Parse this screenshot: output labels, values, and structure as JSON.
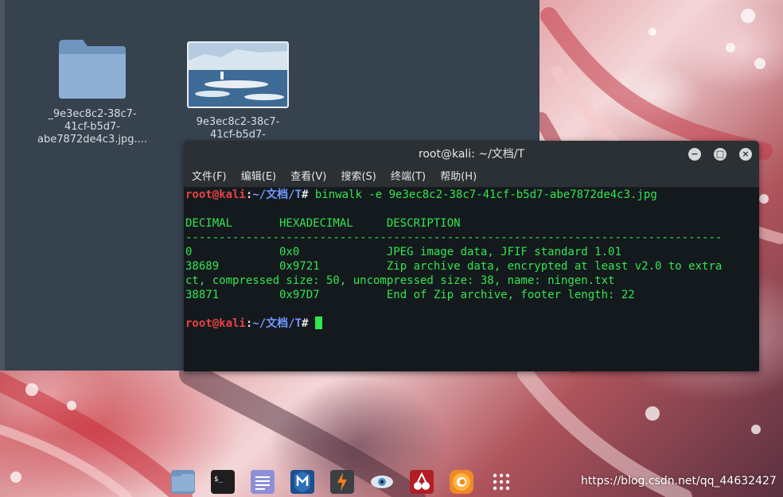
{
  "desktop": {
    "files": [
      {
        "label_lines": [
          "_9e3ec8c2-38c7-",
          "41cf-b5d7-",
          "abe7872de4c3.jpg...."
        ],
        "icon": "folder-icon"
      },
      {
        "label_lines": [
          "9e3ec8c2-38c7-",
          "41cf-b5d7-"
        ],
        "icon": "image-thumbnail"
      }
    ]
  },
  "terminal": {
    "title": "root@kali: ~/文档/T",
    "menu": [
      "文件(F)",
      "编辑(E)",
      "查看(V)",
      "搜索(S)",
      "终端(T)",
      "帮助(H)"
    ],
    "prompt_user": "root@kali",
    "prompt_sep": ":",
    "prompt_path": "~/文档/T",
    "prompt_hash": "#",
    "command": " binwalk -e 9e3ec8c2-38c7-41cf-b5d7-abe7872de4c3.jpg",
    "header": "DECIMAL       HEXADECIMAL     DESCRIPTION",
    "divider": "--------------------------------------------------------------------------------",
    "rows": [
      "0             0x0             JPEG image data, JFIF standard 1.01",
      "38689         0x9721          Zip archive data, encrypted at least v2.0 to extra",
      "ct, compressed size: 50, uncompressed size: 38, name: ningen.txt",
      "38871         0x97D7          End of Zip archive, footer length: 22"
    ],
    "colors": {
      "output": "#31e64e",
      "user": "#e64242",
      "path": "#6f98ff"
    }
  },
  "window_controls": {
    "minimize": "−",
    "maximize": "□",
    "close": "×"
  },
  "dock": {
    "icons": [
      "files-icon",
      "terminal-icon",
      "text-editor-icon",
      "metasploit-icon",
      "burpsuite-icon",
      "eye-icon",
      "cherrytree-icon",
      "firefox-icon",
      "app-grid-icon"
    ]
  },
  "watermark": "https://blog.csdn.net/qq_44632427"
}
